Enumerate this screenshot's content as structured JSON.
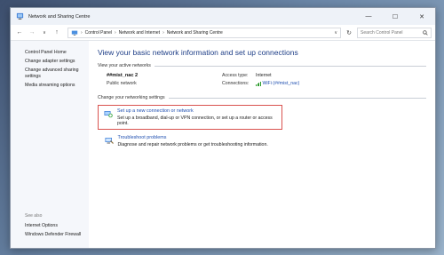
{
  "window": {
    "title": "Network and Sharing Centre",
    "controls": {
      "minimize": "—",
      "maximize": "☐",
      "close": "✕"
    }
  },
  "address": {
    "path": [
      "Control Panel",
      "Network and Internet",
      "Network and Sharing Centre"
    ],
    "search_placeholder": "Search Control Panel",
    "icons": {
      "back": "arrow-left-icon",
      "forward": "arrow-right-icon",
      "recent": "chevron-down-icon",
      "up": "arrow-up-icon",
      "refresh": "refresh-icon",
      "search": "search-icon"
    }
  },
  "sidebar": {
    "items": [
      "Control Panel Home",
      "Change adapter settings",
      "Change advanced sharing settings",
      "Media streaming options"
    ],
    "see_also_label": "See also",
    "see_also_items": [
      "Internet Options",
      "Windows Defender Firewall"
    ]
  },
  "main": {
    "title": "View your basic network information and set up connections",
    "active_networks_heading": "View your active networks",
    "network": {
      "name": "##mist_nac 2",
      "type": "Public network",
      "access_type_label": "Access type:",
      "access_type_value": "Internet",
      "connections_label": "Connections:",
      "connections_value": "WiFi (##mist_nac)"
    },
    "change_settings_heading": "Change your networking settings",
    "tasks": [
      {
        "link": "Set up a new connection or network",
        "desc": "Set up a broadband, dial-up or VPN connection, or set up a router or access point.",
        "icon": "network-setup-icon",
        "highlighted": true
      },
      {
        "link": "Troubleshoot problems",
        "desc": "Diagnose and repair network problems or get troubleshooting information.",
        "icon": "troubleshoot-icon",
        "highlighted": false
      }
    ]
  },
  "colors": {
    "highlight_border": "#d9534f",
    "link": "#1f4fb0",
    "title": "#1e3e87"
  }
}
